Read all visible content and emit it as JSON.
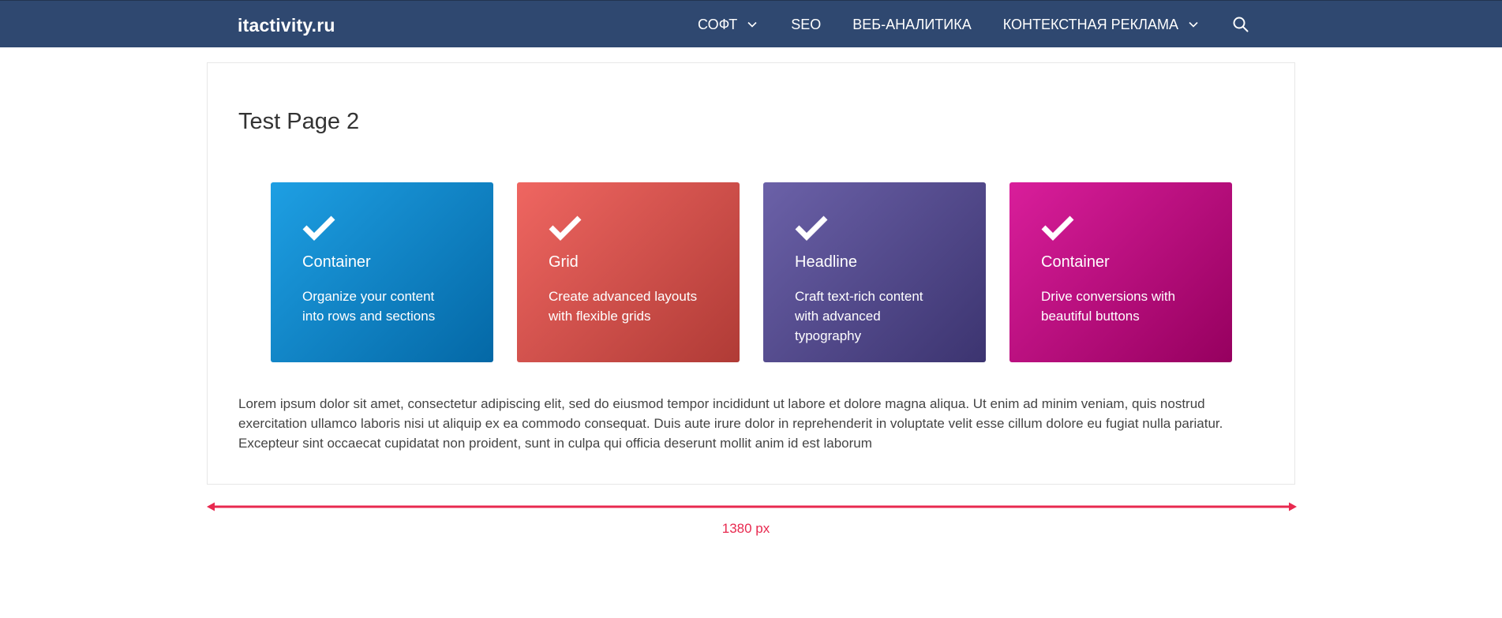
{
  "site": {
    "logo": "itactivity.ru"
  },
  "nav": {
    "items": [
      {
        "label": "СОФТ",
        "has_dropdown": true
      },
      {
        "label": "SEO",
        "has_dropdown": false
      },
      {
        "label": "ВЕБ-АНАЛИТИКА",
        "has_dropdown": false
      },
      {
        "label": "КОНТЕКСТНАЯ РЕКЛАМА",
        "has_dropdown": true
      }
    ],
    "search_icon": "search-icon"
  },
  "page": {
    "title": "Test Page 2",
    "body": "Lorem ipsum dolor sit amet, consectetur adipiscing elit, sed do eiusmod tempor incididunt ut labore et dolore magna aliqua. Ut enim ad minim veniam, quis nostrud exercitation ullamco laboris nisi ut aliquip ex ea commodo consequat. Duis aute irure dolor in reprehenderit in voluptate velit esse cillum dolore eu fugiat nulla pariatur. Excepteur sint occaecat cupidatat non proident, sunt in culpa qui officia deserunt mollit anim id est laborum"
  },
  "cards": [
    {
      "title": "Container",
      "text": "Organize your content into rows and sections",
      "icon": "check-icon",
      "color_from": "#1e9fe3",
      "color_to": "#0468a6"
    },
    {
      "title": "Grid",
      "text": "Create advanced layouts with flexible grids",
      "icon": "check-icon",
      "color_from": "#ef6661",
      "color_to": "#b03b36"
    },
    {
      "title": "Headline",
      "text": "Craft text-rich content with advanced typography",
      "icon": "check-icon",
      "color_from": "#6b61a8",
      "color_to": "#3c3470"
    },
    {
      "title": "Container",
      "text": "Drive conversions with beautiful buttons",
      "icon": "check-icon",
      "color_from": "#d91e9b",
      "color_to": "#96005f"
    }
  ],
  "measure": {
    "label": "1380 px",
    "color": "#e8294f"
  },
  "colors": {
    "header_bg": "#2f4870",
    "title_text": "#333333",
    "body_text": "#444444"
  }
}
